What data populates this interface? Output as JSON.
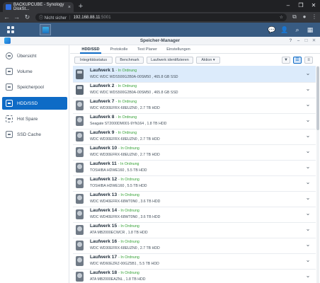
{
  "browser": {
    "tab_title": "BACKUPCUBE - Synology DiskSt...",
    "tab_close": "×",
    "new_tab": "+",
    "min": "–",
    "max": "❐",
    "close": "✕",
    "back": "←",
    "forward": "→",
    "reload": "↻",
    "security": "ⓘ Nicht sicher",
    "separator": "|",
    "url": "192.168.88.11",
    "port": ":5001",
    "star": "☆",
    "ext1": "⧉",
    "ext2": "●",
    "menu": "⋮"
  },
  "dsm": {
    "icons": {
      "chat": "💬",
      "user": "👤",
      "search": "⌕",
      "widgets": "▦"
    }
  },
  "window": {
    "title": "Speicher-Manager",
    "help": "?",
    "minimize": "–",
    "maximize": "□",
    "close": "✕"
  },
  "sidebar": {
    "items": [
      {
        "label": "Übersicht",
        "icon": "overview-icon",
        "active": false
      },
      {
        "label": "Volume",
        "icon": "volume-icon",
        "active": false
      },
      {
        "label": "Speicherpool",
        "icon": "storage-pool-icon",
        "active": false
      },
      {
        "label": "HDD/SSD",
        "icon": "hdd-icon",
        "active": true
      },
      {
        "label": "Hot Spare",
        "icon": "hot-spare-icon",
        "active": false
      },
      {
        "label": "SSD Cache",
        "icon": "ssd-cache-icon",
        "active": false
      }
    ]
  },
  "tabs": [
    "HDD/SSD",
    "Protokolle",
    "Test Planer",
    "Einstellungen"
  ],
  "toolbar": {
    "integrity": "Integritätsstatus",
    "benchmark": "Benchmark",
    "identify": "Laufwerk identifizieren",
    "action": "Aktion",
    "filter_icon": "▼",
    "list_icon": "☰",
    "grid_icon": "≡"
  },
  "accent": "#0e6bc6",
  "status_color": "#35a135",
  "drives": [
    {
      "name": "Laufwerk 1",
      "status": "- In Ordnung",
      "desc": "WDC WDC WDS500G2B0A-00SM50 , 465.8 GB SSD",
      "type": "ssd",
      "selected": true
    },
    {
      "name": "Laufwerk 2",
      "status": "- In Ordnung",
      "desc": "WDC WDC WDS500G2B0A-00SM50 , 465.8 GB SSD",
      "type": "ssd",
      "selected": false
    },
    {
      "name": "Laufwerk 7",
      "status": "- In Ordnung",
      "desc": "WDC WD30EFRX-68EUZN0 , 2.7 TB HDD",
      "type": "hdd",
      "selected": false
    },
    {
      "name": "Laufwerk 8",
      "status": "- In Ordnung",
      "desc": "Seagate ST2000DM001-9YN164 , 1.8 TB HDD",
      "type": "hdd",
      "selected": false
    },
    {
      "name": "Laufwerk 9",
      "status": "- In Ordnung",
      "desc": "WDC WD30EFRX-68EUZN0 , 2.7 TB HDD",
      "type": "hdd",
      "selected": false
    },
    {
      "name": "Laufwerk 10",
      "status": "- In Ordnung",
      "desc": "WDC WD30EFRX-68EUZN0 , 2.7 TB HDD",
      "type": "hdd",
      "selected": false
    },
    {
      "name": "Laufwerk 11",
      "status": "- In Ordnung",
      "desc": "TOSHIBA HDWE160 , 5.5 TB HDD",
      "type": "hdd",
      "selected": false
    },
    {
      "name": "Laufwerk 12",
      "status": "- In Ordnung",
      "desc": "TOSHIBA HDWE160 , 5.5 TB HDD",
      "type": "hdd",
      "selected": false
    },
    {
      "name": "Laufwerk 13",
      "status": "- In Ordnung",
      "desc": "WDC WD40EFRX-68WT0N0 , 3.6 TB HDD",
      "type": "hdd",
      "selected": false
    },
    {
      "name": "Laufwerk 14",
      "status": "- In Ordnung",
      "desc": "WDC WD40EFRX-68WT0N0 , 3.6 TB HDD",
      "type": "hdd",
      "selected": false
    },
    {
      "name": "Laufwerk 15",
      "status": "- In Ordnung",
      "desc": "ATA MB2000ECWCR , 1.8 TB HDD",
      "type": "hdd",
      "selected": false
    },
    {
      "name": "Laufwerk 16",
      "status": "- In Ordnung",
      "desc": "WDC WD30EFRX-68EUZN0 , 2.7 TB HDD",
      "type": "hdd",
      "selected": false
    },
    {
      "name": "Laufwerk 17",
      "status": "- In Ordnung",
      "desc": "WDC WD60EZRZ-00GZ5B1 , 5.5 TB HDD",
      "type": "hdd",
      "selected": false
    },
    {
      "name": "Laufwerk 18",
      "status": "- In Ordnung",
      "desc": "ATA MB2000EAZNL , 1.8 TB HDD",
      "type": "hdd",
      "selected": false
    }
  ]
}
